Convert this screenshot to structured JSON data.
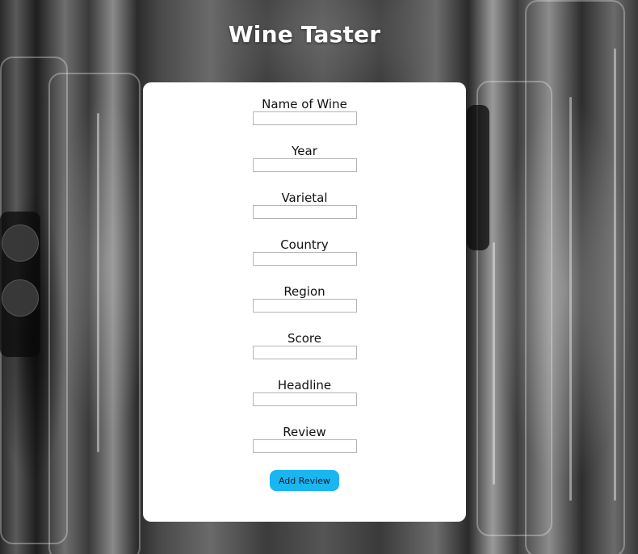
{
  "app": {
    "title": "Wine Taster"
  },
  "form": {
    "fields": [
      {
        "label": "Name of Wine",
        "value": "",
        "placeholder": ""
      },
      {
        "label": "Year",
        "value": "",
        "placeholder": ""
      },
      {
        "label": "Varietal",
        "value": "",
        "placeholder": ""
      },
      {
        "label": "Country",
        "value": "",
        "placeholder": ""
      },
      {
        "label": "Region",
        "value": "",
        "placeholder": ""
      },
      {
        "label": "Score",
        "value": "",
        "placeholder": ""
      },
      {
        "label": "Headline",
        "value": "",
        "placeholder": ""
      },
      {
        "label": "Review",
        "value": "",
        "placeholder": ""
      }
    ],
    "submit_label": "Add Review"
  },
  "colors": {
    "card_background": "#ffffff",
    "button_background": "#1ab6f2",
    "title_color": "#ffffff"
  }
}
